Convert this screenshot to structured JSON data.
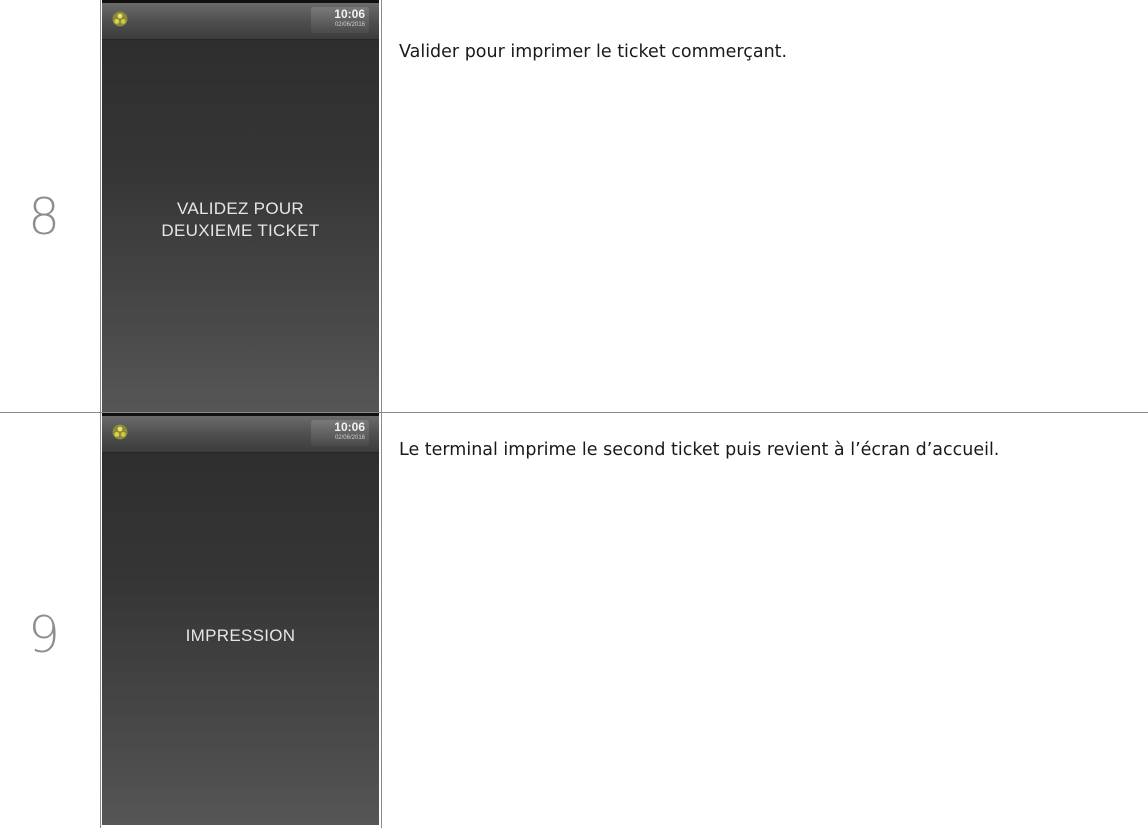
{
  "steps": [
    {
      "number": "8",
      "screen": {
        "clock_time": "10:06",
        "clock_date": "02/06/2016",
        "message_lines": [
          "VALIDEZ POUR",
          "DEUXIEME TICKET"
        ]
      },
      "description": "Valider pour imprimer le ticket commerçant."
    },
    {
      "number": "9",
      "screen": {
        "clock_time": "10:06",
        "clock_date": "02/06/2016",
        "message_lines": [
          "IMPRESSION"
        ]
      },
      "description": "Le terminal imprime le second ticket puis revient à l’écran d’accueil."
    }
  ],
  "colors": {
    "border": "#8a8a8a",
    "step_number": "#8e8e8e",
    "screen_background": "#353535",
    "screen_text": "#e6e6e6"
  },
  "icons": {
    "status_logo": "terminal-logo-icon"
  }
}
